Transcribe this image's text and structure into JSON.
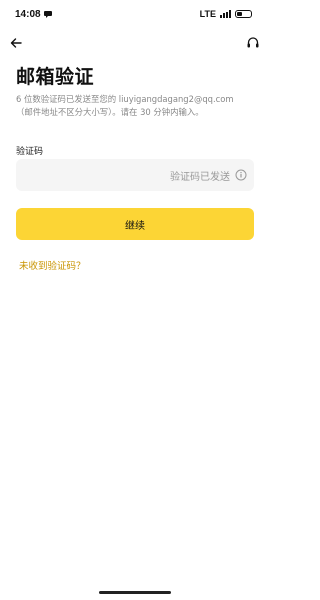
{
  "status_bar": {
    "time": "14:08",
    "network": "LTE"
  },
  "header": {
    "title": "邮箱验证"
  },
  "description": {
    "line1": "6 位数验证码已发送至您的 liuyigangdagang2@qq.com",
    "line2": "（邮件地址不区分大小写）。请在 30 分钟内输入。"
  },
  "code_field": {
    "label": "验证码",
    "value": "",
    "status_text": "验证码已发送"
  },
  "actions": {
    "continue_label": "继续",
    "no_code_link": "未收到验证码？"
  },
  "colors": {
    "accent": "#fcd535",
    "link": "#c99400",
    "input_bg": "#f5f5f5"
  },
  "icons": {
    "back": "arrow-left-icon",
    "support": "headset-icon",
    "info": "info-icon"
  }
}
